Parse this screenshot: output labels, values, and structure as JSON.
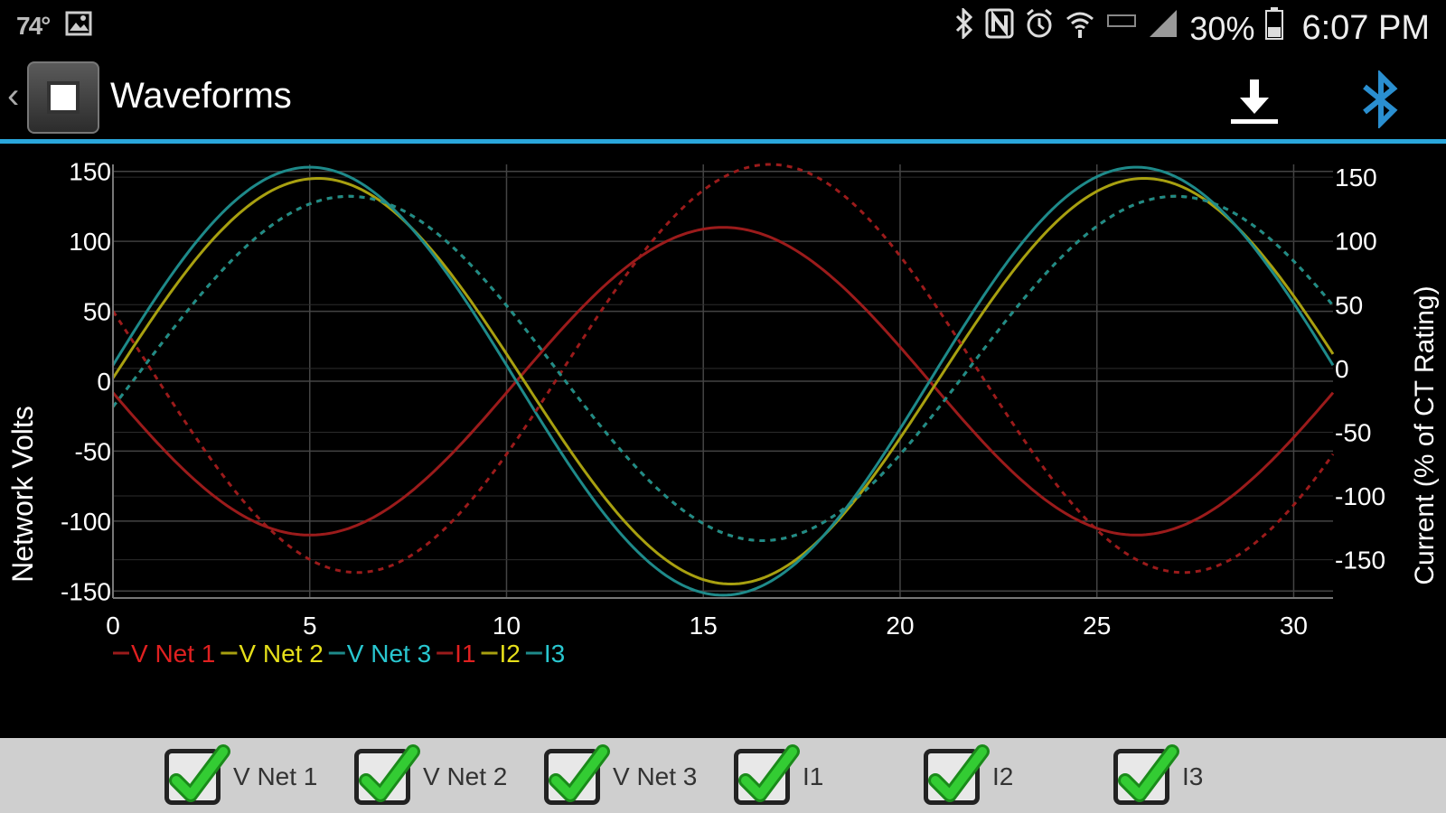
{
  "status_bar": {
    "temp": "74°",
    "battery": "30%",
    "time": "6:07 PM",
    "icons": [
      "image-icon",
      "bluetooth-icon",
      "nfc-icon",
      "alarm-icon",
      "wifi-icon",
      "lte-icon",
      "signal-icon",
      "battery-icon"
    ]
  },
  "header": {
    "title": "Waveforms",
    "icons": [
      "app-icon",
      "download-icon",
      "bluetooth-icon"
    ],
    "accent_color": "#2aa7dc"
  },
  "chart_data": {
    "type": "line",
    "ylabel": "Network Volts",
    "y2label": "Current (% of CT Rating)",
    "x_ticks": [
      "0",
      "5",
      "10",
      "15",
      "20",
      "25",
      "30"
    ],
    "y_ticks": [
      "150",
      "100",
      "50",
      "0",
      "-50",
      "-100",
      "-150"
    ],
    "y2_ticks": [
      "150",
      "100",
      "50",
      "0",
      "-50",
      "-100",
      "-150"
    ],
    "xlim": [
      0,
      31
    ],
    "ylim": [
      -155,
      155
    ],
    "y2lim": [
      -180,
      160
    ],
    "grid": true,
    "legend_position": "bottom-left",
    "series": [
      {
        "name": "V Net 1",
        "axis": "left",
        "dash": false,
        "color": "#9b1b1b",
        "label_color": "#e02020",
        "amp": 110,
        "center": 15.5
      },
      {
        "name": "V Net 2",
        "axis": "left",
        "dash": false,
        "color": "#a8a010",
        "label_color": "#e6df1a",
        "amp": 145,
        "center": 26.2
      },
      {
        "name": "V Net 3",
        "axis": "left",
        "dash": false,
        "color": "#1e8a8a",
        "label_color": "#29c7d0",
        "amp": 153,
        "center": 5.0
      },
      {
        "name": "I1",
        "axis": "right",
        "dash": true,
        "color": "#9b1b1b",
        "label_color": "#e02020",
        "amp": 160,
        "center": 16.7
      },
      {
        "name": "I2",
        "axis": "right",
        "dash": true,
        "color": "#a8a010",
        "label_color": "#e6df1a",
        "amp": 135,
        "center": 27.0
      },
      {
        "name": "I3",
        "axis": "right",
        "dash": true,
        "color": "#1e8a8a",
        "label_color": "#29c7d0",
        "amp": 135,
        "center": 6.0
      }
    ],
    "period": 21.0
  },
  "checkboxes": [
    {
      "label": "V Net 1",
      "checked": true
    },
    {
      "label": "V Net 2",
      "checked": true
    },
    {
      "label": "V Net 3",
      "checked": true
    },
    {
      "label": "I1",
      "checked": true
    },
    {
      "label": "I2",
      "checked": true
    },
    {
      "label": "I3",
      "checked": true
    }
  ]
}
